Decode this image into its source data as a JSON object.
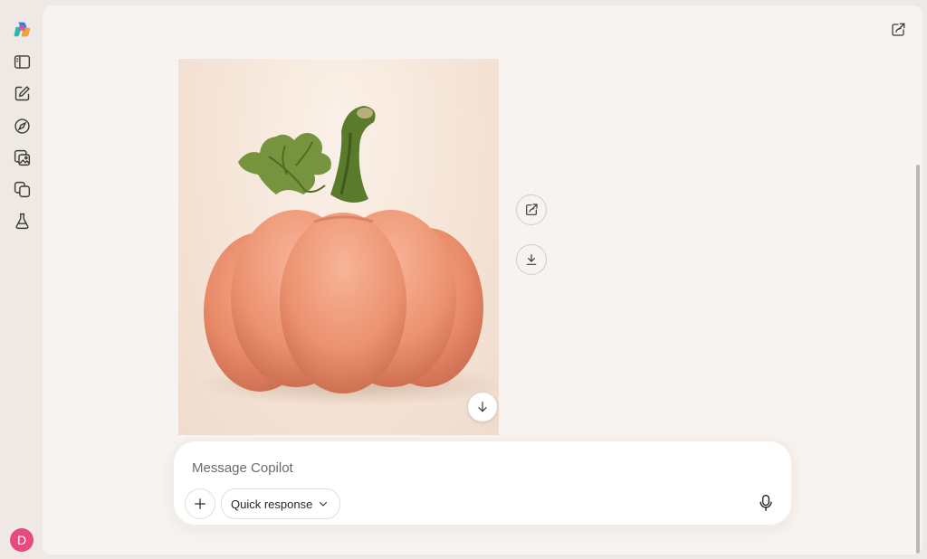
{
  "sidebar": {
    "items": [
      {
        "name": "copilot-logo-icon"
      },
      {
        "name": "sidebar-toggle-icon"
      },
      {
        "name": "new-chat-icon"
      },
      {
        "name": "discover-icon"
      },
      {
        "name": "images-icon"
      },
      {
        "name": "pages-icon"
      },
      {
        "name": "labs-icon"
      }
    ],
    "avatar_initial": "D"
  },
  "header": {
    "share_icon": "share-icon"
  },
  "image": {
    "subject": "pumpkin"
  },
  "image_actions": {
    "share_icon": "share-icon",
    "download_icon": "download-icon"
  },
  "composer": {
    "placeholder": "Message Copilot",
    "value": "",
    "mode_label": "Quick response",
    "mic_icon": "microphone-icon",
    "plus_icon": "plus-icon"
  },
  "colors": {
    "accent_avatar": "#e64a7e",
    "background": "#efe9e5",
    "panel": "#f7f3f0"
  }
}
